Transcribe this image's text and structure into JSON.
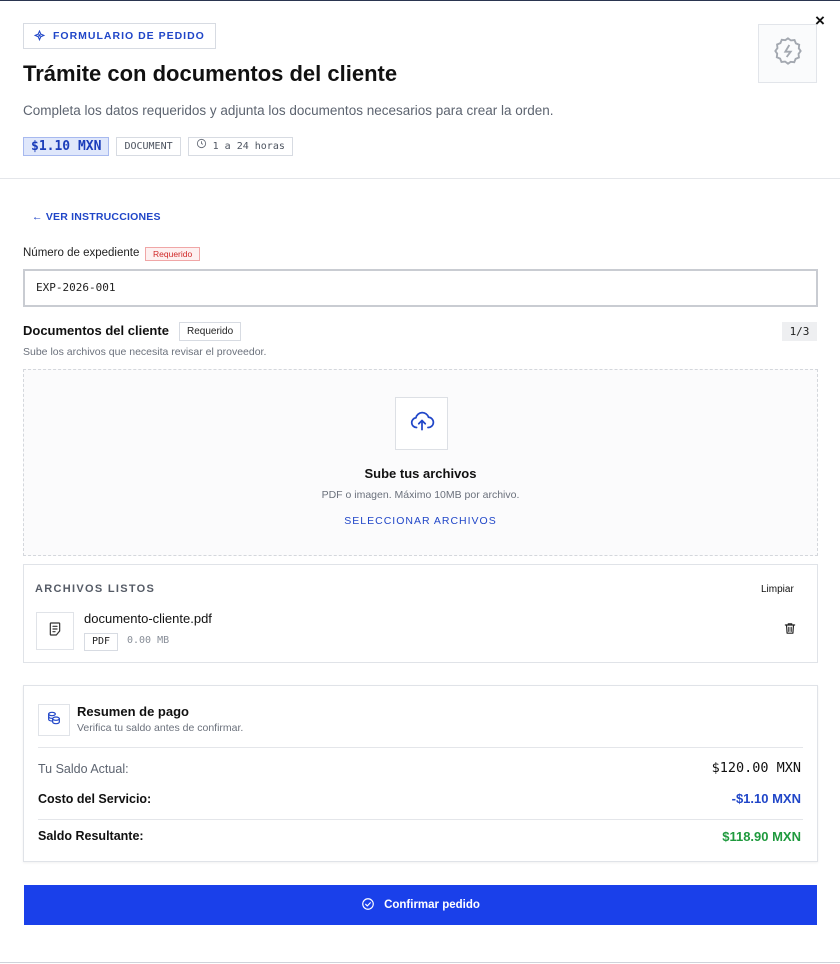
{
  "header": {
    "badge": "FORMULARIO DE PEDIDO",
    "title": "Trámite con documentos del cliente",
    "description": "Completa los datos requeridos y adjunta los documentos necesarios para crear la orden.",
    "price": "$1.10 MXN",
    "type": "DOCUMENT",
    "duration": "1 a 24 horas",
    "close": "×"
  },
  "nav": {
    "back_link": "← VER INSTRUCCIONES"
  },
  "expediente": {
    "label": "Número de expediente",
    "required": "Requerido",
    "value": "EXP-2026-001"
  },
  "documents": {
    "title": "Documentos del cliente",
    "required": "Requerido",
    "counter": "1/3",
    "subtitle": "Sube los archivos que necesita revisar el proveedor.",
    "dropzone": {
      "title": "Sube tus archivos",
      "subtitle": "PDF o imagen. Máximo 10MB por archivo.",
      "button": "SELECCIONAR ARCHIVOS"
    }
  },
  "files": {
    "title": "ARCHIVOS LISTOS",
    "clear": "Limpiar",
    "items": [
      {
        "name": "documento-cliente.pdf",
        "type": "PDF",
        "size": "0.00 MB"
      }
    ]
  },
  "payment": {
    "title": "Resumen de pago",
    "subtitle": "Verifica tu saldo antes de confirmar.",
    "balance_label": "Tu Saldo Actual:",
    "balance_value": "$120.00 MXN",
    "cost_label": "Costo del Servicio:",
    "cost_value": "-$1.10 MXN",
    "result_label": "Saldo Resultante:",
    "result_value": "$118.90 MXN"
  },
  "confirm": {
    "label": "Confirmar pedido"
  },
  "colors": {
    "accent": "#1a40ea",
    "link": "#2046c8",
    "success": "#1f9a3e",
    "danger": "#d02828"
  },
  "icons": {
    "badge": "sparkle-icon",
    "service": "badge-gear-icon",
    "duration": "clock-icon",
    "upload": "cloud-upload-icon",
    "file": "file-text-icon",
    "delete": "trash-icon",
    "payment": "coins-icon",
    "confirm": "check-circle-icon"
  }
}
